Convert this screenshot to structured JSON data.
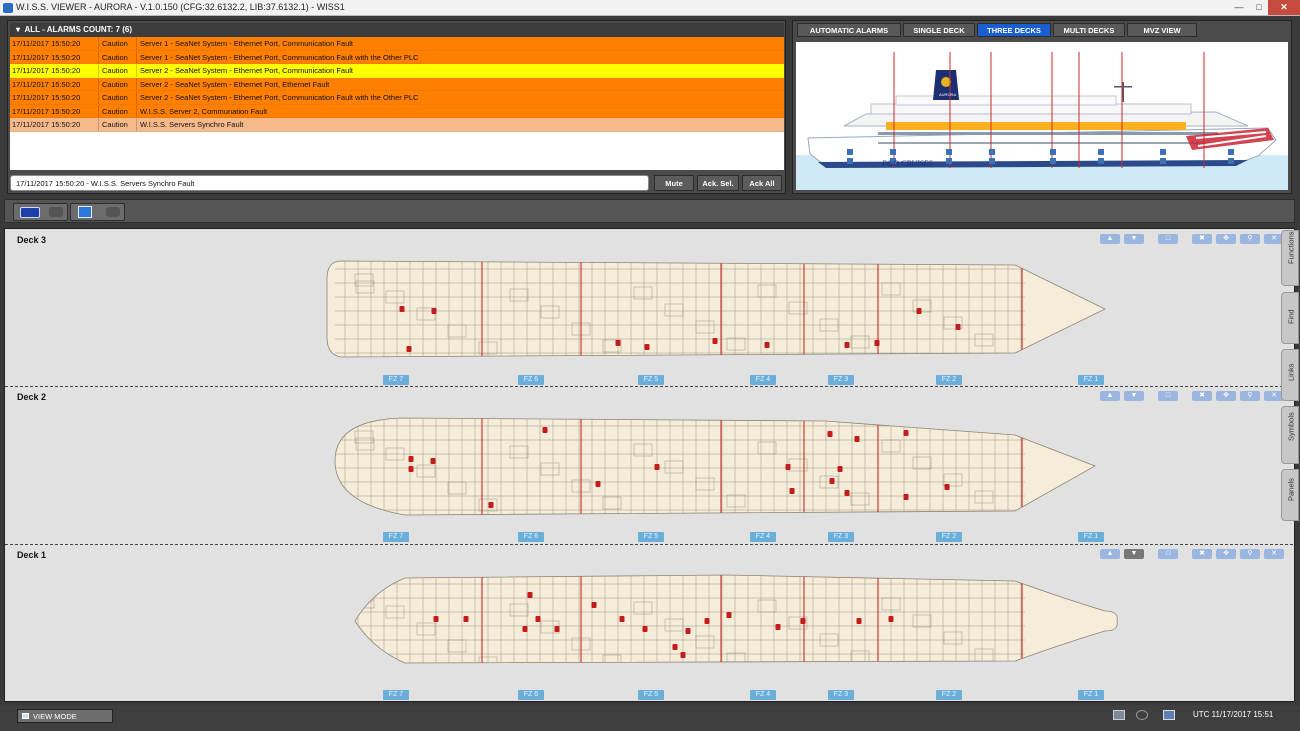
{
  "window": {
    "title": "W.I.S.S. VIEWER - AURORA - V.1.0.150 (CFG:32.6132.2, LIB:37.6132.1) - WISS1"
  },
  "alarms": {
    "header": "ALL - ALARMS COUNT: 7 (6)",
    "rows": [
      {
        "time": "17/11/2017 15:50:20",
        "type": "Caution",
        "message": "Server 1 - SeaNet System - Ethernet Port, Communication Fault",
        "color": "#ff7f00"
      },
      {
        "time": "17/11/2017 15:50:20",
        "type": "Caution",
        "message": "Server 1 - SeaNet System - Ethernet Port, Communication Fault with the Other PLC",
        "color": "#ff7f00"
      },
      {
        "time": "17/11/2017 15:50:20",
        "type": "Caution",
        "message": "Server 2 - SeaNet System - Ethernet Port, Communication Fault",
        "color": "#ffff00"
      },
      {
        "time": "17/11/2017 15:50:20",
        "type": "Caution",
        "message": "Server 2 - SeaNet System - Ethernet Port, Ethernet Fault",
        "color": "#ff7f00"
      },
      {
        "time": "17/11/2017 15:50:20",
        "type": "Caution",
        "message": "Server 2 - SeaNet System - Ethernet Port, Communication Fault with the Other PLC",
        "color": "#ff7f00"
      },
      {
        "time": "17/11/2017 15:50:20",
        "type": "Caution",
        "message": "W.I.S.S. Server 2, Communation Fault",
        "color": "#ff7f00"
      },
      {
        "time": "17/11/2017 15:50:20",
        "type": "Caution",
        "message": "W.I.S.S. Servers Synchro Fault",
        "color": "#f6b98a"
      }
    ],
    "status_line": "17/11/2017 15:50:20 - W.I.S.S. Servers Synchro Fault",
    "buttons": {
      "mute": "Mute",
      "ack_sel": "Ack. Sel.",
      "ack_all": "Ack All"
    }
  },
  "view_tabs": {
    "automatic_alarms": "AUTOMATIC ALARMS",
    "single_deck": "SINGLE DECK",
    "three_decks": "THREE DECKS",
    "multi_decks": "MULTI DECKS",
    "mvz_view": "MVZ VIEW",
    "active": "THREE DECKS"
  },
  "ship": {
    "hull_text": "P&O CRUISES",
    "funnel_text": "AURORA"
  },
  "decks": [
    {
      "name": "Deck 3",
      "zones": [
        "FZ 7",
        "FZ 6",
        "FZ 5",
        "FZ 4",
        "FZ 3",
        "FZ 2",
        "FZ 1"
      ]
    },
    {
      "name": "Deck 2",
      "zones": [
        "FZ 7",
        "FZ 6",
        "FZ 5",
        "FZ 4",
        "FZ 3",
        "FZ 2",
        "FZ 1"
      ]
    },
    {
      "name": "Deck 1",
      "zones": [
        "FZ 7",
        "FZ 6",
        "FZ 5",
        "FZ 4",
        "FZ 3",
        "FZ 2",
        "FZ 1"
      ]
    }
  ],
  "side_tabs": [
    "Functions",
    "Find",
    "Links",
    "Symbols",
    "Panels"
  ],
  "status_bar": {
    "view_mode": "VIEW MODE",
    "clock": "UTC 11/17/2017 15:51"
  },
  "colors": {
    "deck_fill": "#f5ecd9",
    "zone_line": "#cc2b2b",
    "symbol": "#c41c1c",
    "sea": "#cfe9f6"
  }
}
